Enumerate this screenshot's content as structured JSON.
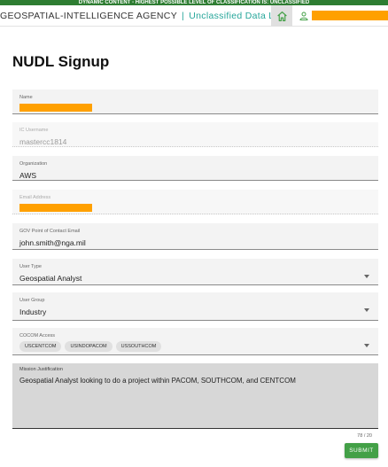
{
  "banner": {
    "text": "DYNAMIC CONTENT - HIGHEST POSSIBLE LEVEL OF CLASSIFICATION IS: UNCLASSIFIED"
  },
  "header": {
    "agency": "GEOSPATIAL-INTELLIGENCE AGENCY",
    "separator": "|",
    "product": "Unclassified Data Lake",
    "home_icon": "home-icon",
    "user_icon": "user-icon"
  },
  "page": {
    "title": "NUDL Signup"
  },
  "form": {
    "name": {
      "label": "Name"
    },
    "username": {
      "label": "IC Username",
      "value": "mastercc1814"
    },
    "organization": {
      "label": "Organization",
      "value": "AWS"
    },
    "email": {
      "label": "Email Address"
    },
    "gov_poc": {
      "label": "GOV Point of Contact Email",
      "value": "john.smith@nga.mil"
    },
    "user_type": {
      "label": "User Type",
      "value": "Geospatial Analyst"
    },
    "user_group": {
      "label": "User Group",
      "value": "Industry"
    },
    "cocom": {
      "label": "COCOM Access",
      "chips": [
        "USCENTCOM",
        "USINDOPACOM",
        "USSOUTHCOM"
      ]
    },
    "justification": {
      "label": "Mission Justification",
      "value": "Geospatial Analyst looking to do a project within PACOM, SOUTHCOM, and CENTCOM",
      "counter": "78 / 20"
    },
    "submit_label": "SUBMIT"
  },
  "colors": {
    "banner": "#2e7d32",
    "accent": "#26a69a",
    "redaction": "#ffa000",
    "submit": "#43a047"
  }
}
